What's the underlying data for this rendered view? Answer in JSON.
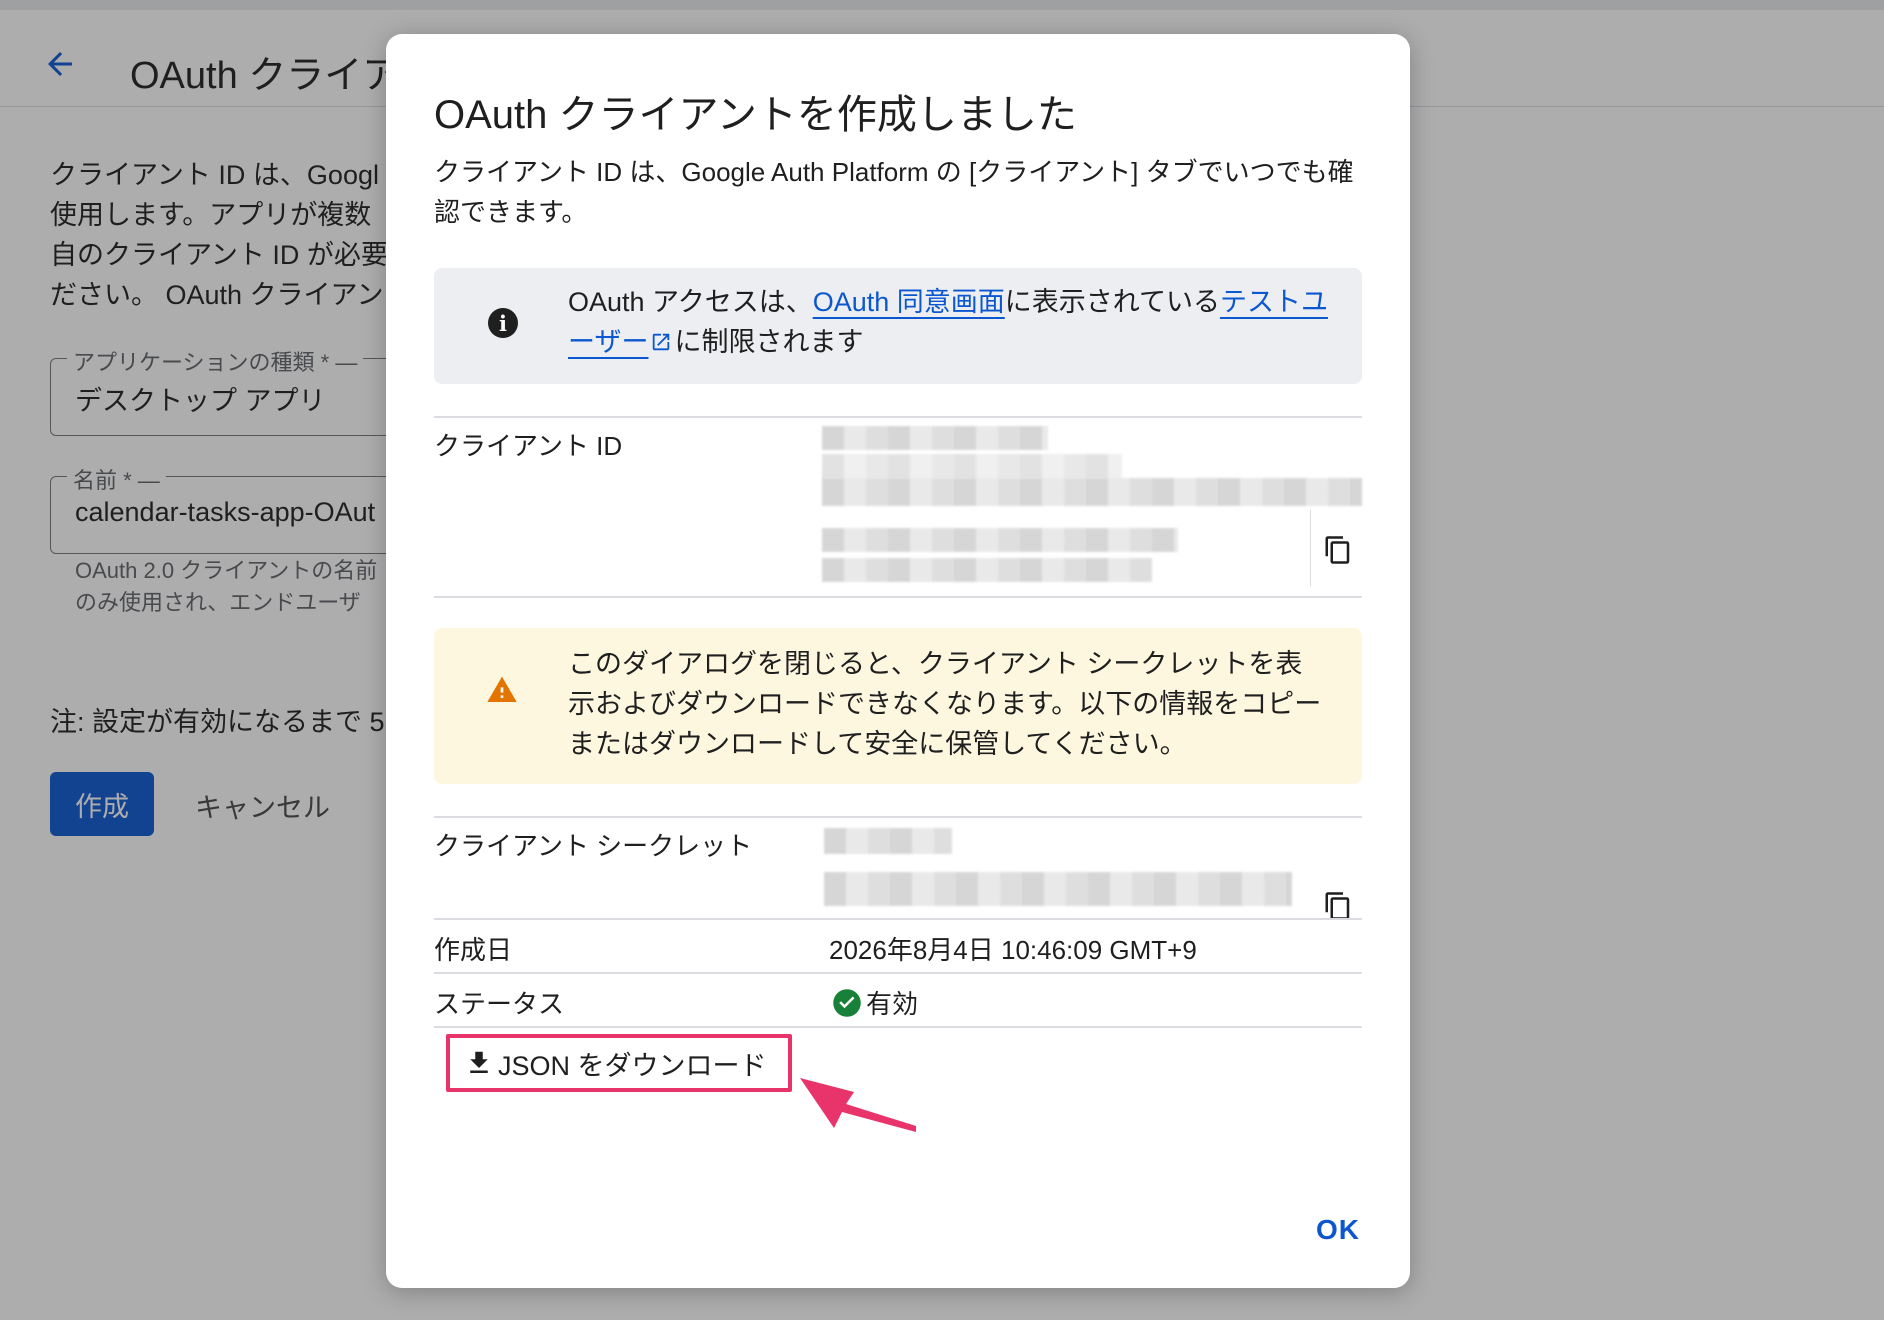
{
  "background": {
    "title": "OAuth クライア",
    "description": "クライアント ID は、Googl\n使用します。アプリが複数\n自のクライアント ID が必要\nださい。 OAuth クライアン",
    "app_type_label": "アプリケーションの種類 * ―",
    "app_type_value": "デスクトップ アプリ",
    "name_label": "名前 * ―",
    "name_value": "calendar-tasks-app-OAut",
    "name_hint": "OAuth 2.0 クライアントの名前\nのみ使用され、エンドユーザ",
    "note": "注: 設定が有効になるまで 5",
    "create_label": "作成",
    "cancel_label": "キャンセル"
  },
  "dialog": {
    "title": "OAuth クライアントを作成しました",
    "subtitle": "クライアント ID は、Google Auth Platform の [クライアント] タブでいつでも確認できます。",
    "info": {
      "prefix": "OAuth アクセスは、",
      "link1": "OAuth 同意画面",
      "middle": "に表示されている",
      "link2": "テストユーザー",
      "suffix": "に制限されます"
    },
    "client_id_label": "クライアント ID",
    "warning": "このダイアログを閉じると、クライアント シークレットを表示およびダウンロードできなくなります。以下の情報をコピーまたはダウンロードして安全に保管してください。",
    "client_secret_label": "クライアント シークレット",
    "created_label": "作成日",
    "created_value": "2026年8月4日 10:46:09 GMT+9",
    "status_label": "ステータス",
    "status_value": "有効",
    "download_label": "JSON をダウンロード",
    "ok_label": "OK"
  },
  "colors": {
    "accent": "#0b57d0",
    "highlight": "#e8336b",
    "success": "#188038",
    "warning": "#e37400"
  }
}
